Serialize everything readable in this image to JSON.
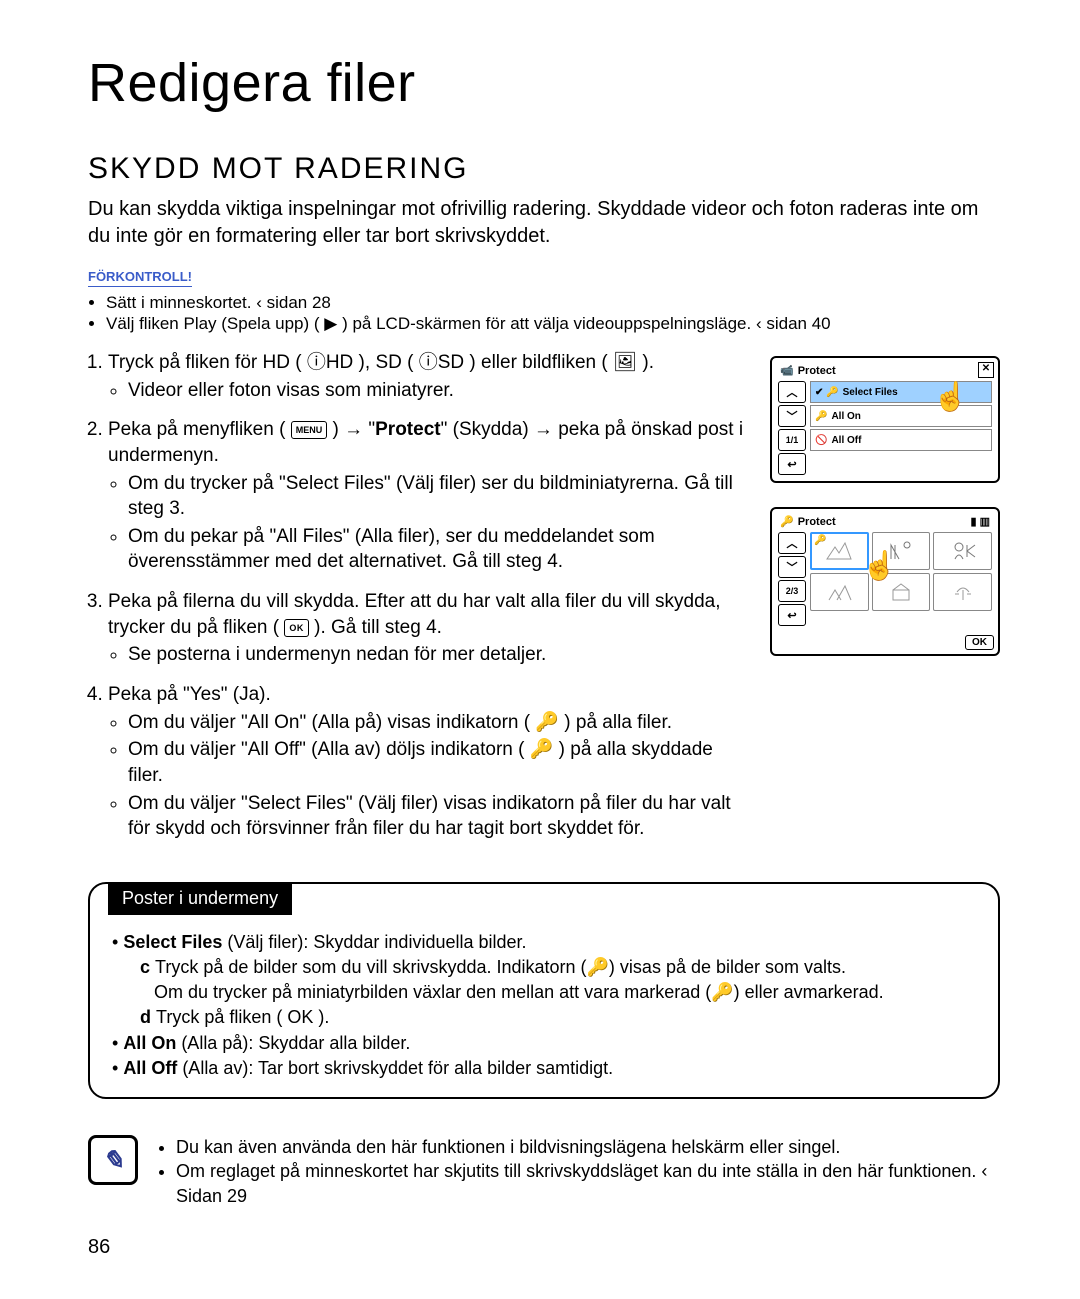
{
  "title": "Redigera ﬁler",
  "section_title": "SKYDD MOT RADERING",
  "intro": "Du kan skydda viktiga inspelningar mot ofrivillig radering. Skyddade videor och foton raderas inte om du inte gör en formatering eller tar bort skrivskyddet.",
  "precheck_label": "FÖRKONTROLL!",
  "precheck_items": [
    "Sätt i minneskortet.  ‹ sidan 28",
    "Välj fliken Play (Spela upp) ( ▶ ) på LCD-skärmen för att välja videouppspelningsläge. ‹ sidan 40"
  ],
  "steps": [
    {
      "lead": "1.",
      "text": "Tryck på fliken för HD ( ⓘHD ), SD ( ⓘSD ) eller bildfliken ( 🖼 ).",
      "bullets": [
        "Videor eller foton visas som miniatyrer."
      ]
    },
    {
      "lead": "2.",
      "text_a": "Peka på menyfliken (",
      "menu_label": "MENU",
      "text_b": ") → \"",
      "keyword1": "Protect",
      "text_c": "\" (Skydda) → peka på önskad post i undermenyn.",
      "bullets": [
        "Om du trycker på \"Select Files\" (Välj filer) ser du bildminiatyrerna. Gå till steg 3.",
        "Om du pekar på \"All Files\" (Alla filer), ser du meddelandet som överensstämmer med det alternativet. Gå till steg 4."
      ]
    },
    {
      "lead": "3.",
      "text_a": "Peka på filerna du vill skydda. Efter att du har valt alla filer du vill skydda, trycker du på fliken (",
      "ok_label": "OK",
      "text_b": "). Gå till steg 4.",
      "bullets": [
        "Se posterna i undermenyn nedan för mer detaljer."
      ]
    },
    {
      "lead": "4.",
      "text": "Peka på \"Yes\" (Ja).",
      "bullets": [
        "Om du väljer \"All On\" (Alla på) visas indikatorn ( 🔑 ) på alla filer.",
        "Om du väljer \"All Off\" (Alla av) döljs indikatorn ( 🔑 ) på alla skyddade filer.",
        "Om du väljer \"Select Files\" (Välj filer) visas indikatorn på filer du har valt för skydd och försvinner från filer du har tagit bort skyddet för."
      ]
    }
  ],
  "panel1": {
    "title": "Protect",
    "pager": "1/1",
    "options": [
      {
        "icon": "✔ 🔑",
        "label": "Select Files"
      },
      {
        "icon": "🔑",
        "label": "All On"
      },
      {
        "icon": "🚫",
        "label": "All Off"
      }
    ]
  },
  "panel2": {
    "title": "Protect",
    "pager": "2/3",
    "ok": "OK"
  },
  "subbox": {
    "tag": "Poster i undermeny",
    "lines": [
      {
        "lead": "Select Files",
        "tail": " (Välj filer): Skyddar individuella bilder."
      },
      {
        "indent": "c",
        "text": "Tryck på de bilder som du vill skrivskydda. Indikatorn (🔑) visas på de bilder som valts."
      },
      {
        "indent": "",
        "text": "Om du trycker på miniatyrbilden växlar den mellan att vara markerad (🔑) eller avmarkerad."
      },
      {
        "indent": "d",
        "text": "Tryck på fliken ( OK )."
      },
      {
        "lead": "All On",
        "tail": " (Alla på): Skyddar alla bilder."
      },
      {
        "lead": "All Off",
        "tail": " (Alla av): Tar bort skrivskyddet för alla bilder samtidigt."
      }
    ]
  },
  "note_items": [
    "Du kan även använda den här funktionen i bildvisningslägena helskärm eller singel.",
    "Om reglaget på minneskortet har skjutits till skrivskyddsläget kan du inte ställa in den här funktionen.  ‹ Sidan 29"
  ],
  "page_number": "86"
}
